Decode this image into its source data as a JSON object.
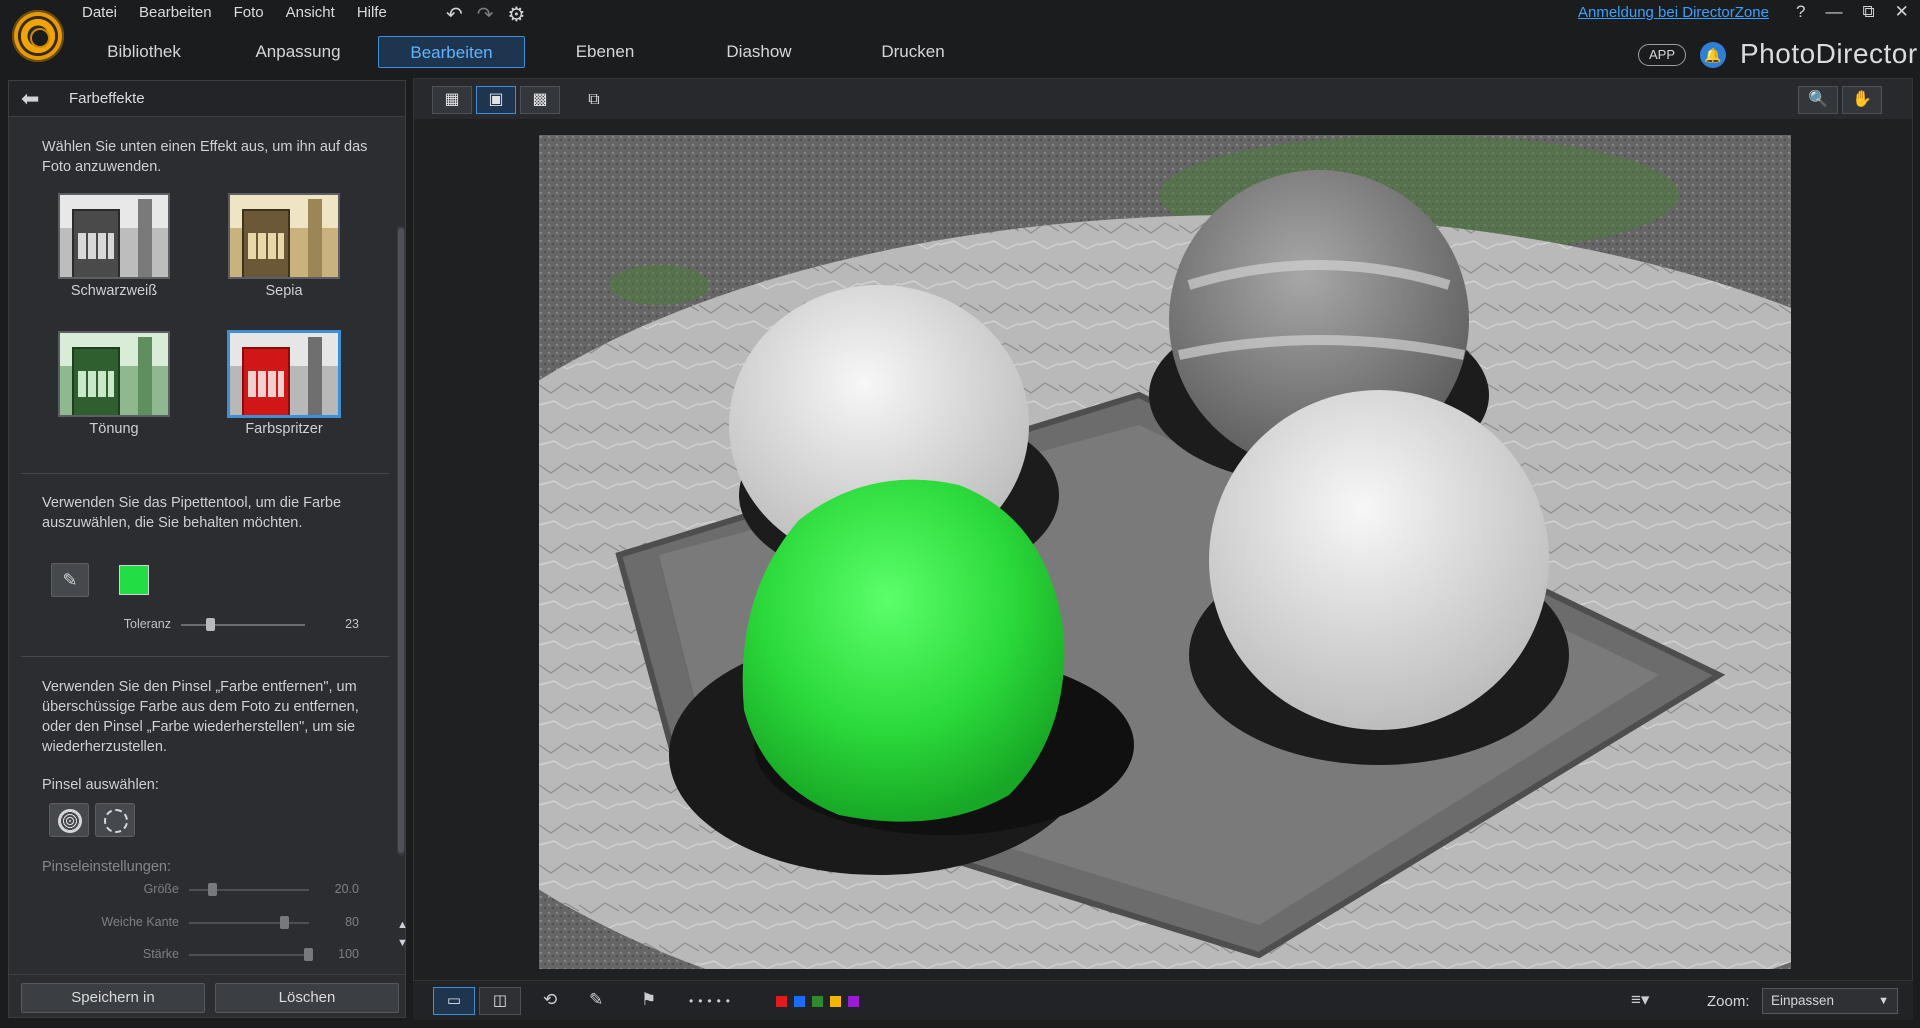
{
  "menu": {
    "items": [
      "Datei",
      "Bearbeiten",
      "Foto",
      "Ansicht",
      "Hilfe"
    ]
  },
  "titlebar": {
    "signin": "Anmeldung bei DirectorZone",
    "help": "?",
    "minimize": "—",
    "restore": "⧉",
    "close": "✕"
  },
  "tabs": [
    "Bibliothek",
    "Anpassung",
    "Bearbeiten",
    "Ebenen",
    "Diashow",
    "Drucken"
  ],
  "active_tab": "Bearbeiten",
  "brand": {
    "app_badge": "APP",
    "name": "PhotoDirector"
  },
  "panel": {
    "title": "Farbeffekte",
    "intro": "Wählen Sie unten einen Effekt aus, um ihn auf das Foto anzuwenden.",
    "effects": [
      {
        "label": "Schwarzweiß",
        "tone": "bw"
      },
      {
        "label": "Sepia",
        "tone": "sepia"
      },
      {
        "label": "Tönung",
        "tone": "green"
      },
      {
        "label": "Farbspritzer",
        "tone": "splash",
        "selected": true
      }
    ],
    "pipette_text": "Verwenden Sie das Pipettentool, um die Farbe auszuwählen, die Sie behalten möchten.",
    "picked_color": "#22dd44",
    "tolerance": {
      "label": "Toleranz",
      "value": 23,
      "max": 100
    },
    "brush_text": "Verwenden Sie den Pinsel „Farbe entfernen\", um überschüssige Farbe aus dem Foto zu entfernen, oder den Pinsel „Farbe wiederherstellen\", um sie wiederherzustellen.",
    "brush_choose": "Pinsel auswählen:",
    "brush_settings": "Pinseleinstellungen:",
    "brush_sliders": [
      {
        "label": "Größe",
        "value": "20.0",
        "fraction": 0.2
      },
      {
        "label": "Weiche Kante",
        "value": "80",
        "fraction": 0.8
      },
      {
        "label": "Stärke",
        "value": "100",
        "fraction": 1.0
      }
    ],
    "save_button": "Speichern in",
    "delete_button": "Löschen"
  },
  "bottom": {
    "zoom_label": "Zoom:",
    "zoom_value": "Einpassen",
    "color_labels": [
      "#e01b1b",
      "#1a6cff",
      "#2e8a2e",
      "#f4b400",
      "#9b1bd6"
    ]
  }
}
